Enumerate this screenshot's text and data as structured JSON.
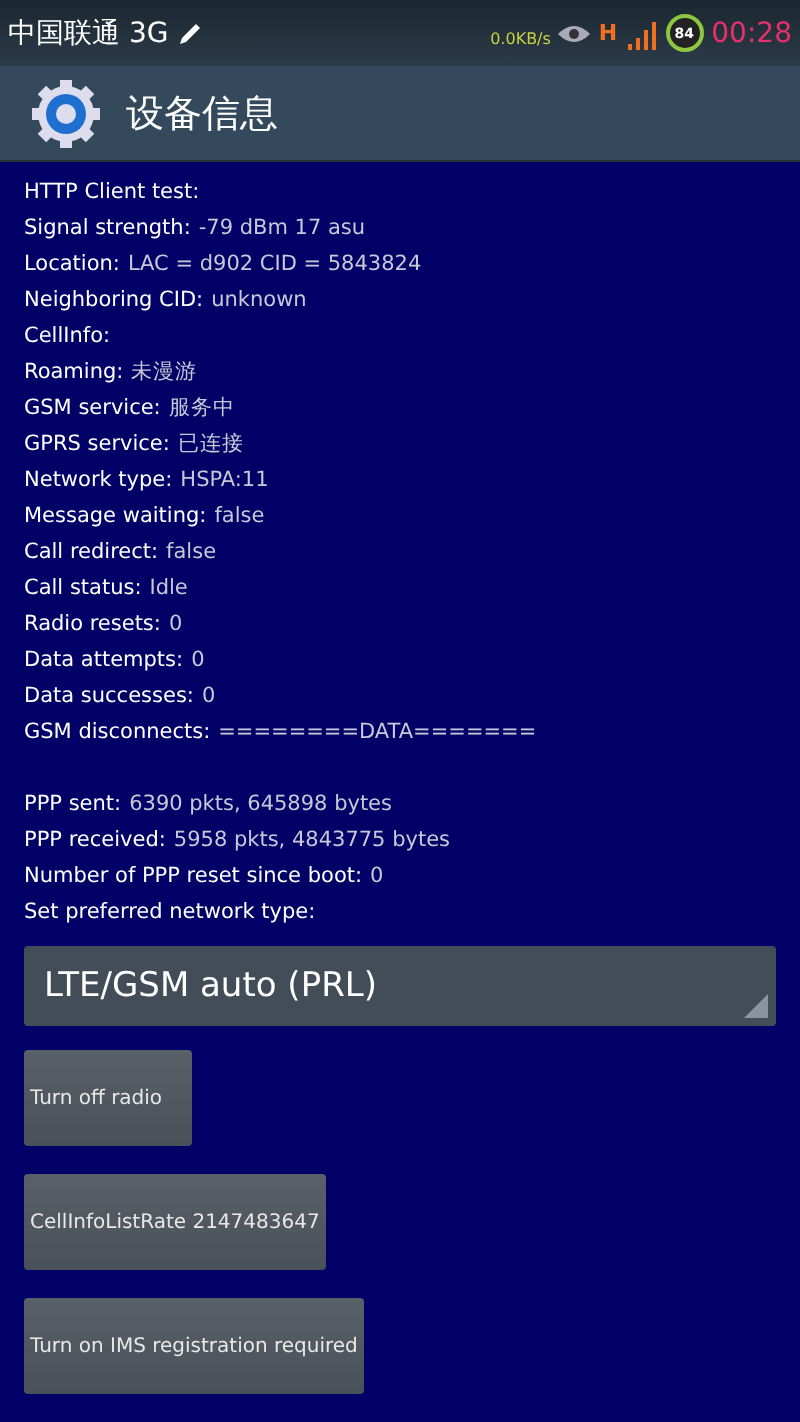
{
  "status_bar": {
    "carrier": "中国联通 3G",
    "speed": "0.0KB/s",
    "network": "H",
    "battery": "84",
    "time": "00:28"
  },
  "action_bar": {
    "title": "设备信息"
  },
  "sections": [
    [
      {
        "label": "HTTP Client test:"
      },
      {
        "label": "Signal strength:",
        "value": "-79 dBm   17 asu"
      },
      {
        "label": "Location:",
        "value": "LAC = d902   CID = 5843824"
      },
      {
        "label": "Neighboring CID:",
        "value": "unknown"
      },
      {
        "label": "CellInfo:"
      },
      {
        "label": "Roaming:",
        "value": "未漫游"
      },
      {
        "label": "GSM service:",
        "value": "服务中"
      },
      {
        "label": "GPRS service:",
        "value": "已连接"
      },
      {
        "label": "Network type:",
        "value": "HSPA:11"
      },
      {
        "label": "Message waiting:",
        "value": "false"
      },
      {
        "label": "Call redirect:",
        "value": "false"
      },
      {
        "label": "Call status:",
        "value": "Idle"
      },
      {
        "label": "Radio resets:",
        "value": "0"
      },
      {
        "label": "Data attempts:",
        "value": "0"
      },
      {
        "label": "Data successes:",
        "value": "0"
      },
      {
        "label": "GSM disconnects:",
        "value": "========DATA======="
      }
    ],
    [
      {
        "label": "PPP sent:",
        "value": "6390 pkts, 645898 bytes"
      },
      {
        "label": "PPP received:",
        "value": "5958 pkts, 4843775 bytes"
      },
      {
        "label": "Number of PPP reset since boot:",
        "value": "0"
      },
      {
        "label": "Set preferred network type:"
      }
    ]
  ],
  "network_type_spinner": {
    "value": "LTE/GSM auto (PRL)"
  },
  "buttons": [
    "Turn off radio",
    "CellInfoListRate 2147483647",
    "Turn on IMS registration required"
  ]
}
